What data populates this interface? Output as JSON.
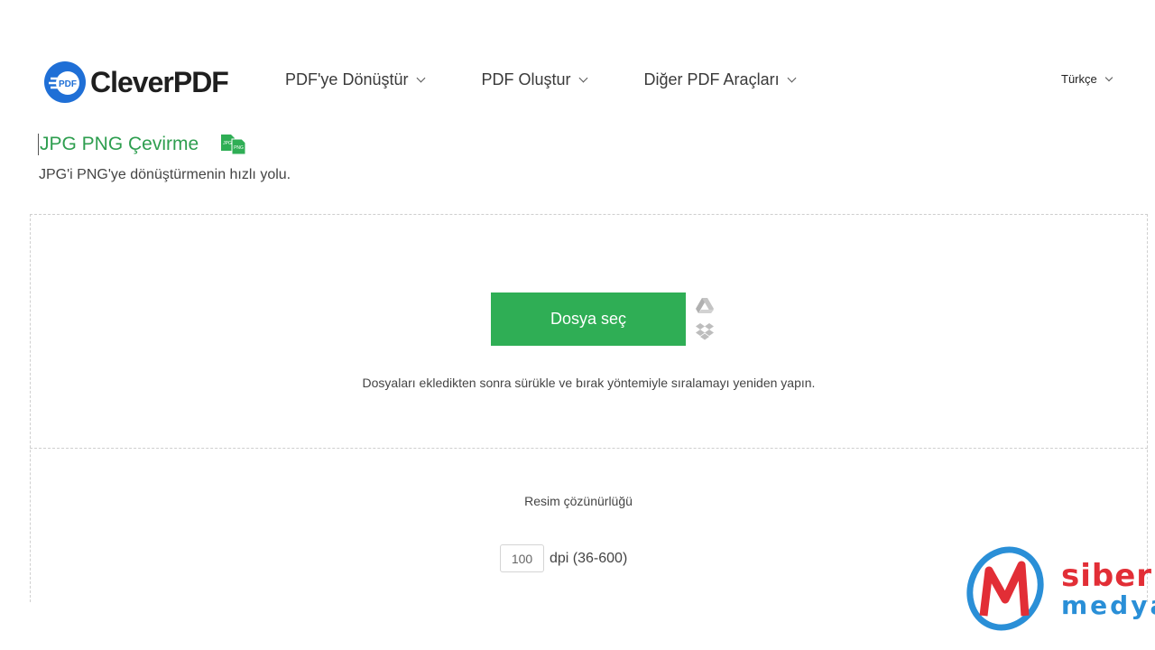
{
  "header": {
    "brand": "CleverPDF",
    "logo_mark_text": "PDF",
    "nav": [
      {
        "label": "PDF'ye Dönüştür"
      },
      {
        "label": "PDF Oluştur"
      },
      {
        "label": "Diğer PDF Araçları"
      }
    ],
    "language": "Türkçe"
  },
  "page": {
    "title": "JPG PNG Çevirme",
    "title_icon": "jpg-png-file-icon",
    "subtitle": "JPG'i PNG'ye dönüştürmenin hızlı yolu."
  },
  "upload": {
    "button_label": "Dosya seç",
    "icons": [
      "google-drive-icon",
      "dropbox-icon"
    ],
    "hint": "Dosyaları ekledikten sonra sürükle ve bırak yöntemiyle sıralamayı yeniden yapın."
  },
  "options": {
    "resolution_label": "Resim çözünürlüğü",
    "dpi_value": "100",
    "dpi_unit": "dpi (36-600)"
  },
  "watermark": {
    "line1": "siber",
    "line2": "medya"
  },
  "colors": {
    "accent_green": "#2fae55",
    "title_green": "#2e9e4f",
    "logo_blue": "#1f6fd6",
    "watermark_red": "#e22e36",
    "watermark_blue": "#2a8fd7"
  }
}
